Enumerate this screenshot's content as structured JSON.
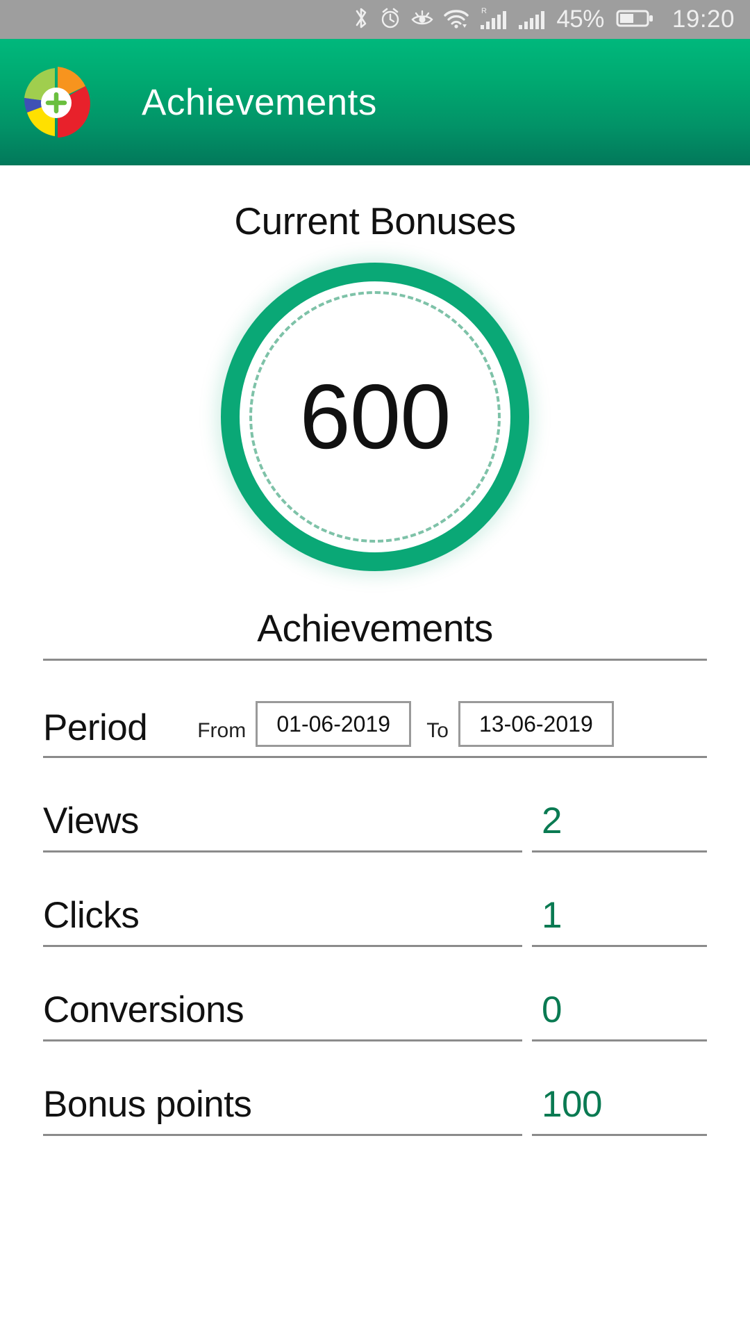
{
  "status_bar": {
    "icons": [
      "bluetooth-icon",
      "alarm-icon",
      "eye-comfort-icon",
      "wifi-icon",
      "signal-roaming-icon",
      "signal-icon"
    ],
    "roaming_label": "R",
    "battery_percent": "45%",
    "time": "19:20",
    "background_color": "#9e9e9e",
    "foreground_color": "#efefef"
  },
  "app_bar": {
    "title": "Achievements",
    "logo_name": "pie-chart-plus-logo",
    "gradient_top": "#00b87c",
    "gradient_bottom": "#02785a",
    "title_color": "#ffffff"
  },
  "main": {
    "bonuses_title": "Current Bonuses",
    "gauge": {
      "value": "600",
      "ring_color": "#0aa876",
      "dash_color": "#7ec2a8",
      "value_color": "#111111"
    },
    "achievements_title": "Achievements",
    "period": {
      "label": "Period",
      "from_label": "From",
      "from_value": "01-06-2019",
      "to_label": "To",
      "to_value": "13-06-2019"
    },
    "stats": [
      {
        "label": "Views",
        "value": "2"
      },
      {
        "label": "Clicks",
        "value": "1"
      },
      {
        "label": "Conversions",
        "value": "0"
      },
      {
        "label": "Bonus points",
        "value": "100"
      }
    ],
    "value_color": "#0a7a52",
    "divider_color": "#8b8b8b"
  }
}
